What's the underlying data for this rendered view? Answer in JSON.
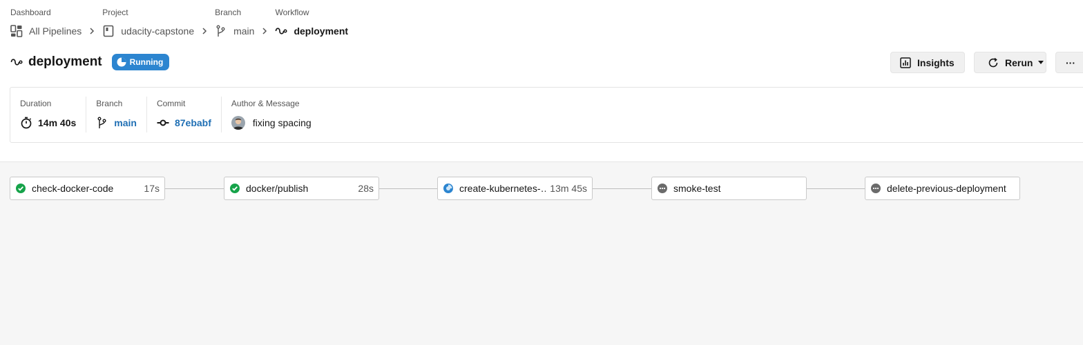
{
  "breadcrumb": {
    "dashboard": {
      "label": "Dashboard",
      "value": "All Pipelines"
    },
    "project": {
      "label": "Project",
      "value": "udacity-capstone"
    },
    "branch": {
      "label": "Branch",
      "value": "main"
    },
    "workflow": {
      "label": "Workflow",
      "value": "deployment"
    }
  },
  "header": {
    "title": "deployment",
    "status": "Running",
    "insights_label": "Insights",
    "rerun_label": "Rerun",
    "more_label": "···"
  },
  "info": {
    "duration": {
      "label": "Duration",
      "value": "14m 40s"
    },
    "branch": {
      "label": "Branch",
      "value": "main"
    },
    "commit": {
      "label": "Commit",
      "value": "87ebabf"
    },
    "author": {
      "label": "Author & Message",
      "message": "fixing spacing"
    }
  },
  "jobs": [
    {
      "name": "check-docker-code",
      "time": "17s",
      "status": "success"
    },
    {
      "name": "docker/publish",
      "time": "28s",
      "status": "success"
    },
    {
      "name": "create-kubernetes-…",
      "time": "13m 45s",
      "status": "running"
    },
    {
      "name": "smoke-test",
      "time": "",
      "status": "pending"
    },
    {
      "name": "delete-previous-deployment",
      "time": "",
      "status": "pending"
    }
  ],
  "colors": {
    "success": "#16a34a",
    "running": "#2c85d0",
    "pending": "#6b6b6b",
    "link": "#1f6fb4"
  }
}
